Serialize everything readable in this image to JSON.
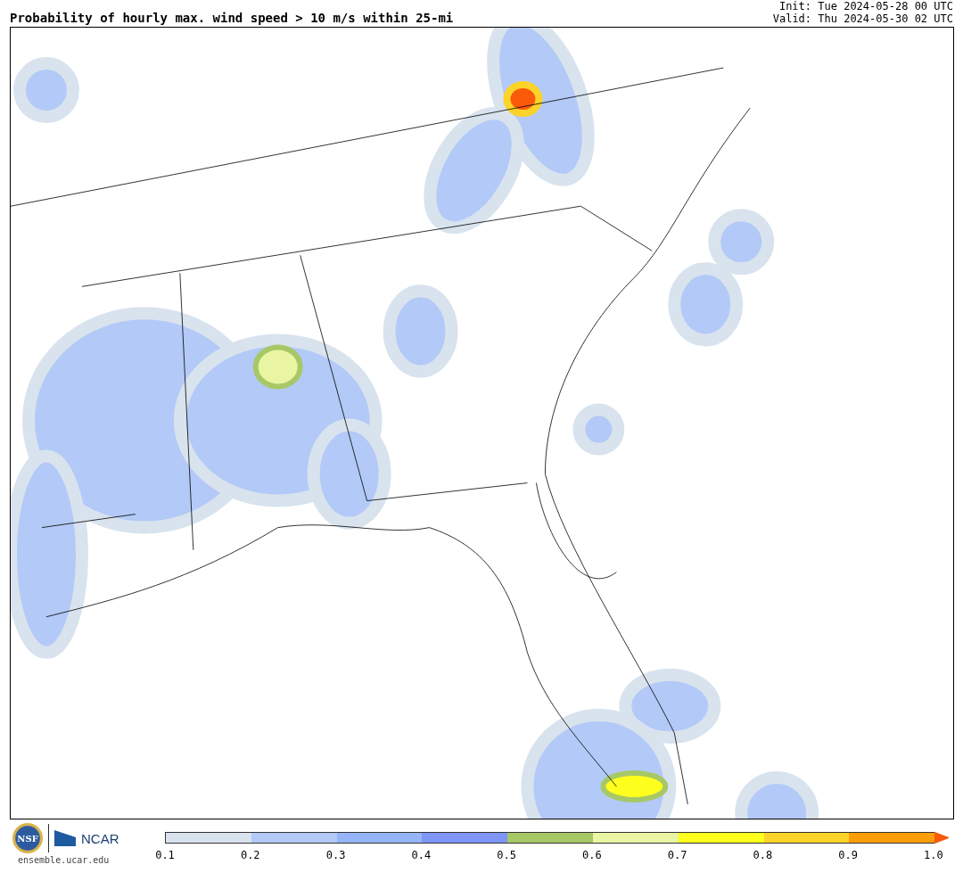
{
  "title": "Probability of hourly max. wind speed > 10 m/s within 25-mi",
  "init": "Init: Tue 2024-05-28 00 UTC",
  "valid": "Valid: Thu 2024-05-30 02 UTC",
  "logos": {
    "nsf": "NSF",
    "ncar": "NCAR",
    "url": "ensemble.ucar.edu"
  },
  "colorbar": {
    "segments": [
      {
        "kind": "box",
        "color": "#d8e3ee"
      },
      {
        "kind": "box",
        "color": "#b3c9f7"
      },
      {
        "kind": "box",
        "color": "#96b4f8"
      },
      {
        "kind": "box",
        "color": "#7f96f7"
      },
      {
        "kind": "box",
        "color": "#a7c866"
      },
      {
        "kind": "box",
        "color": "#e9f5a2"
      },
      {
        "kind": "box",
        "color": "#ffff1e"
      },
      {
        "kind": "box",
        "color": "#fbd329"
      },
      {
        "kind": "box",
        "color": "#fb9d09"
      },
      {
        "kind": "arrow",
        "color": "#f55a0a"
      }
    ],
    "ticks": [
      "0.1",
      "0.2",
      "0.3",
      "0.4",
      "0.5",
      "0.6",
      "0.7",
      "0.8",
      "0.9",
      "1.0"
    ]
  }
}
